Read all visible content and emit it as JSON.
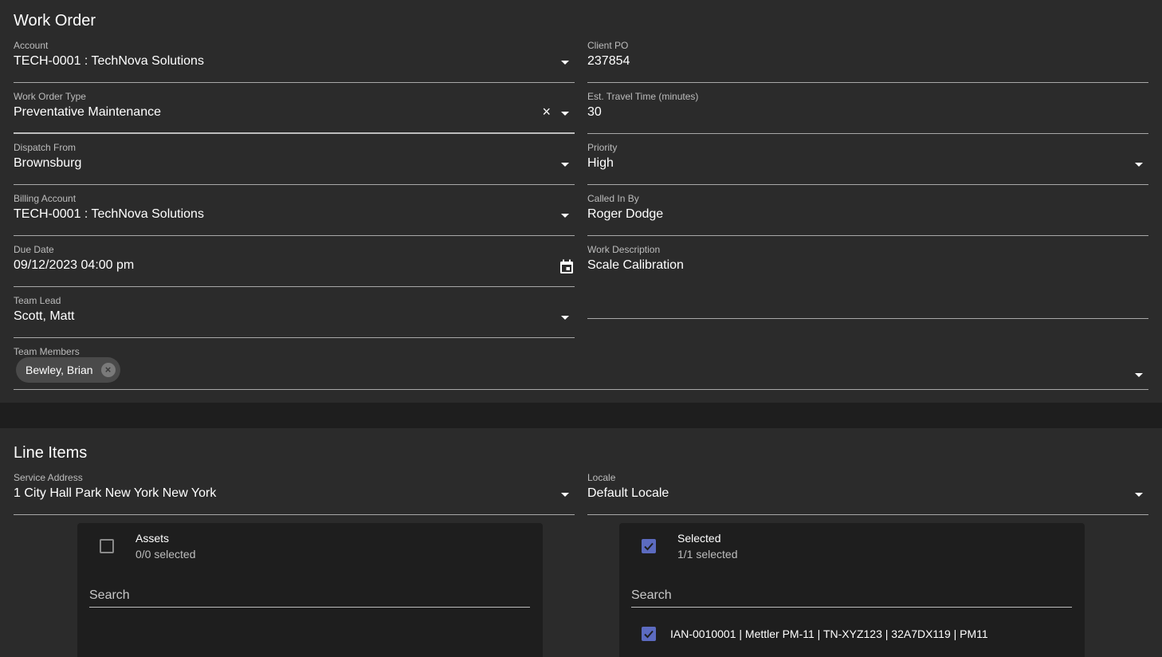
{
  "work_order": {
    "title": "Work Order",
    "fields": {
      "account": {
        "label": "Account",
        "value": "TECH-0001 : TechNova Solutions"
      },
      "client_po": {
        "label": "Client PO",
        "value": "237854"
      },
      "work_order_type": {
        "label": "Work Order Type",
        "value": "Preventative Maintenance"
      },
      "est_travel_time": {
        "label": "Est. Travel Time (minutes)",
        "value": "30"
      },
      "dispatch_from": {
        "label": "Dispatch From",
        "value": "Brownsburg"
      },
      "priority": {
        "label": "Priority",
        "value": "High"
      },
      "billing_account": {
        "label": "Billing Account",
        "value": "TECH-0001 : TechNova Solutions"
      },
      "called_in_by": {
        "label": "Called In By",
        "value": "Roger Dodge"
      },
      "due_date": {
        "label": "Due Date",
        "value": "09/12/2023 04:00 pm"
      },
      "work_description": {
        "label": "Work Description",
        "value": "Scale Calibration"
      },
      "team_lead": {
        "label": "Team Lead",
        "value": "Scott, Matt"
      },
      "team_members": {
        "label": "Team Members",
        "chips": [
          "Bewley, Brian"
        ]
      }
    },
    "icons": {
      "clear": "×",
      "dropdown": "triangle-down",
      "calendar": "calendar-icon",
      "chip_remove": "×"
    }
  },
  "line_items": {
    "title": "Line Items",
    "fields": {
      "service_address": {
        "label": "Service Address",
        "value": "1 City Hall Park New York New York"
      },
      "locale": {
        "label": "Locale",
        "value": "Default Locale"
      }
    },
    "assets_list": {
      "title": "Assets",
      "count": "0/0 selected",
      "checked": false,
      "search_placeholder": "Search",
      "items": []
    },
    "selected_list": {
      "title": "Selected",
      "count": "1/1 selected",
      "checked": true,
      "search_placeholder": "Search",
      "items": [
        {
          "text": "IAN-0010001 | Mettler PM-11 | TN-XYZ123 | 32A7DX119 | PM11",
          "checked": true
        }
      ]
    }
  },
  "colors": {
    "background": "#1e1e1e",
    "card": "#2b2b2b",
    "accent_checkbox": "#5c6bc0",
    "chip": "#4a4a4a"
  }
}
